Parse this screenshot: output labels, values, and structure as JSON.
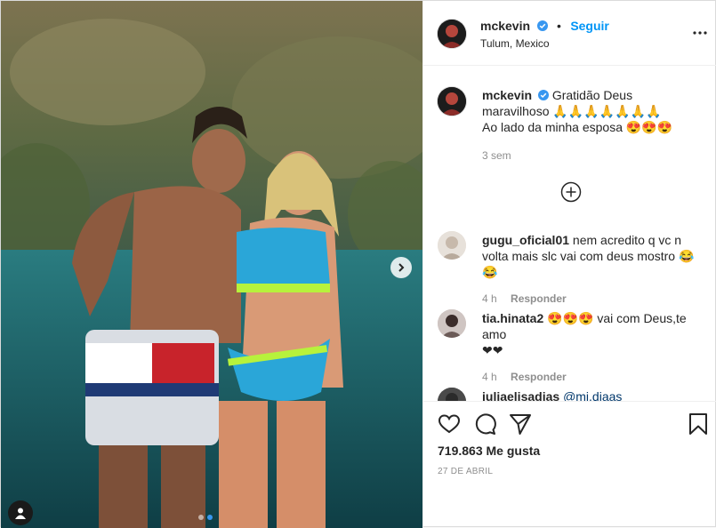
{
  "post": {
    "username": "mckevin",
    "follow_label": "Seguir",
    "separator": "•",
    "location": "Tulum, Mexico",
    "photo_description": "Couple posing in cenote water",
    "carousel": {
      "total": 2,
      "active": 1
    }
  },
  "caption": {
    "username": "mckevin",
    "line1": "Gratidão Deus",
    "line2": "maravilhoso 🙏🙏🙏🙏🙏🙏🙏",
    "line3": "Ao lado da minha esposa 😍😍😍",
    "time": "3 sem"
  },
  "comments": [
    {
      "username": "gugu_oficial01",
      "text1": "nem acredito q vc n",
      "text2": "volta mais slc vai com deus mostro 😂😂",
      "time": "4 h",
      "reply_label": "Responder"
    },
    {
      "username": "tia.hinata2",
      "text1": "😍😍😍 vai com Deus,te amo",
      "text2": "❤❤",
      "time": "4 h",
      "reply_label": "Responder"
    },
    {
      "username": "juliaelisadias",
      "text1": "@mi.diaas",
      "text2": "",
      "time": "",
      "reply_label": ""
    }
  ],
  "stats": {
    "likes": "719.863 Me gusta",
    "date": "27 DE ABRIL"
  },
  "colors": {
    "accent": "#0095f6",
    "verified": "#3897f0",
    "text": "#262626",
    "muted": "#8e8e8e"
  },
  "icons": {
    "like": "heart-icon",
    "comment": "comment-icon",
    "share": "paper-plane-icon",
    "save": "bookmark-icon",
    "more": "more-dots-icon",
    "next": "chevron-right-icon",
    "tag": "user-tag-icon",
    "load_more": "plus-circle-icon"
  }
}
